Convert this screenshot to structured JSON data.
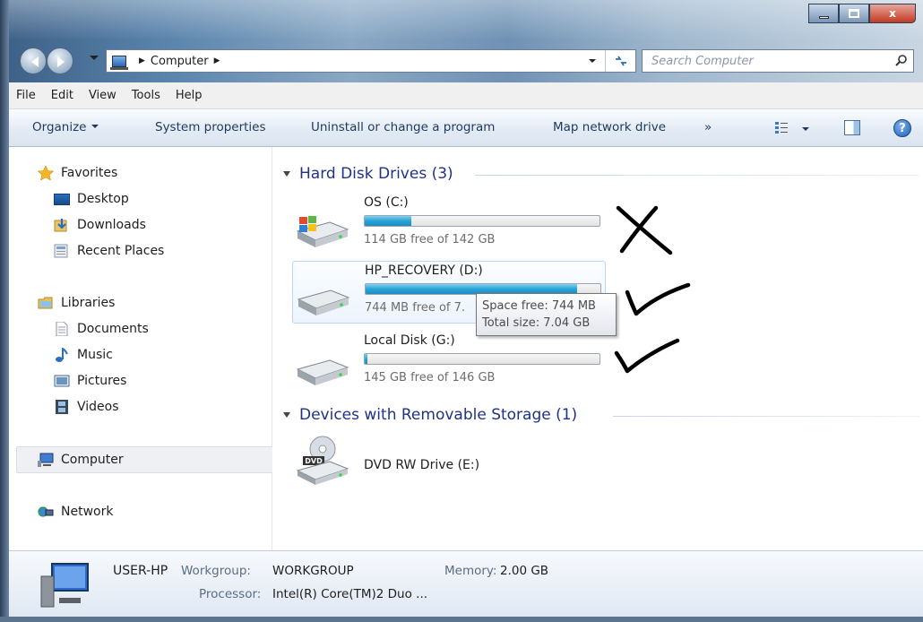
{
  "window": {
    "controls": {
      "minimize": "–",
      "maximize": "□",
      "close": "x"
    }
  },
  "address": {
    "crumb": "Computer",
    "search_placeholder": "Search Computer"
  },
  "menu": [
    "File",
    "Edit",
    "View",
    "Tools",
    "Help"
  ],
  "commands": {
    "organize": "Organize",
    "system_properties": "System properties",
    "uninstall": "Uninstall or change a program",
    "map_drive": "Map network drive",
    "more": "»"
  },
  "nav": {
    "favorites": "Favorites",
    "desktop": "Desktop",
    "downloads": "Downloads",
    "recent": "Recent Places",
    "libraries": "Libraries",
    "documents": "Documents",
    "music": "Music",
    "pictures": "Pictures",
    "videos": "Videos",
    "computer": "Computer",
    "network": "Network"
  },
  "groups": {
    "hdd": "Hard Disk Drives (3)",
    "removable": "Devices with Removable Storage (1)"
  },
  "drives": [
    {
      "name": "OS (C:)",
      "free_text": "114 GB free of 142 GB",
      "used_fraction": 0.2
    },
    {
      "name": "HP_RECOVERY (D:)",
      "free_text": "744 MB free of 7.",
      "used_fraction": 0.9
    },
    {
      "name": "Local Disk (G:)",
      "free_text": "145 GB free of 146 GB",
      "used_fraction": 0.01
    }
  ],
  "dvd": {
    "name": "DVD RW Drive (E:)",
    "badge": "DVD"
  },
  "tooltip": {
    "line1": "Space free: 744 MB",
    "line2": "Total size: 7.04 GB"
  },
  "details": {
    "computer_name": "USER-HP",
    "workgroup_label": "Workgroup:",
    "workgroup_value": "WORKGROUP",
    "memory_label": "Memory:",
    "memory_value": "2.00 GB",
    "processor_label": "Processor:",
    "processor_value": "Intel(R) Core(TM)2 Duo ..."
  },
  "colors": {
    "link_blue": "#1e3287",
    "drive_fill": "#27a3d6"
  }
}
